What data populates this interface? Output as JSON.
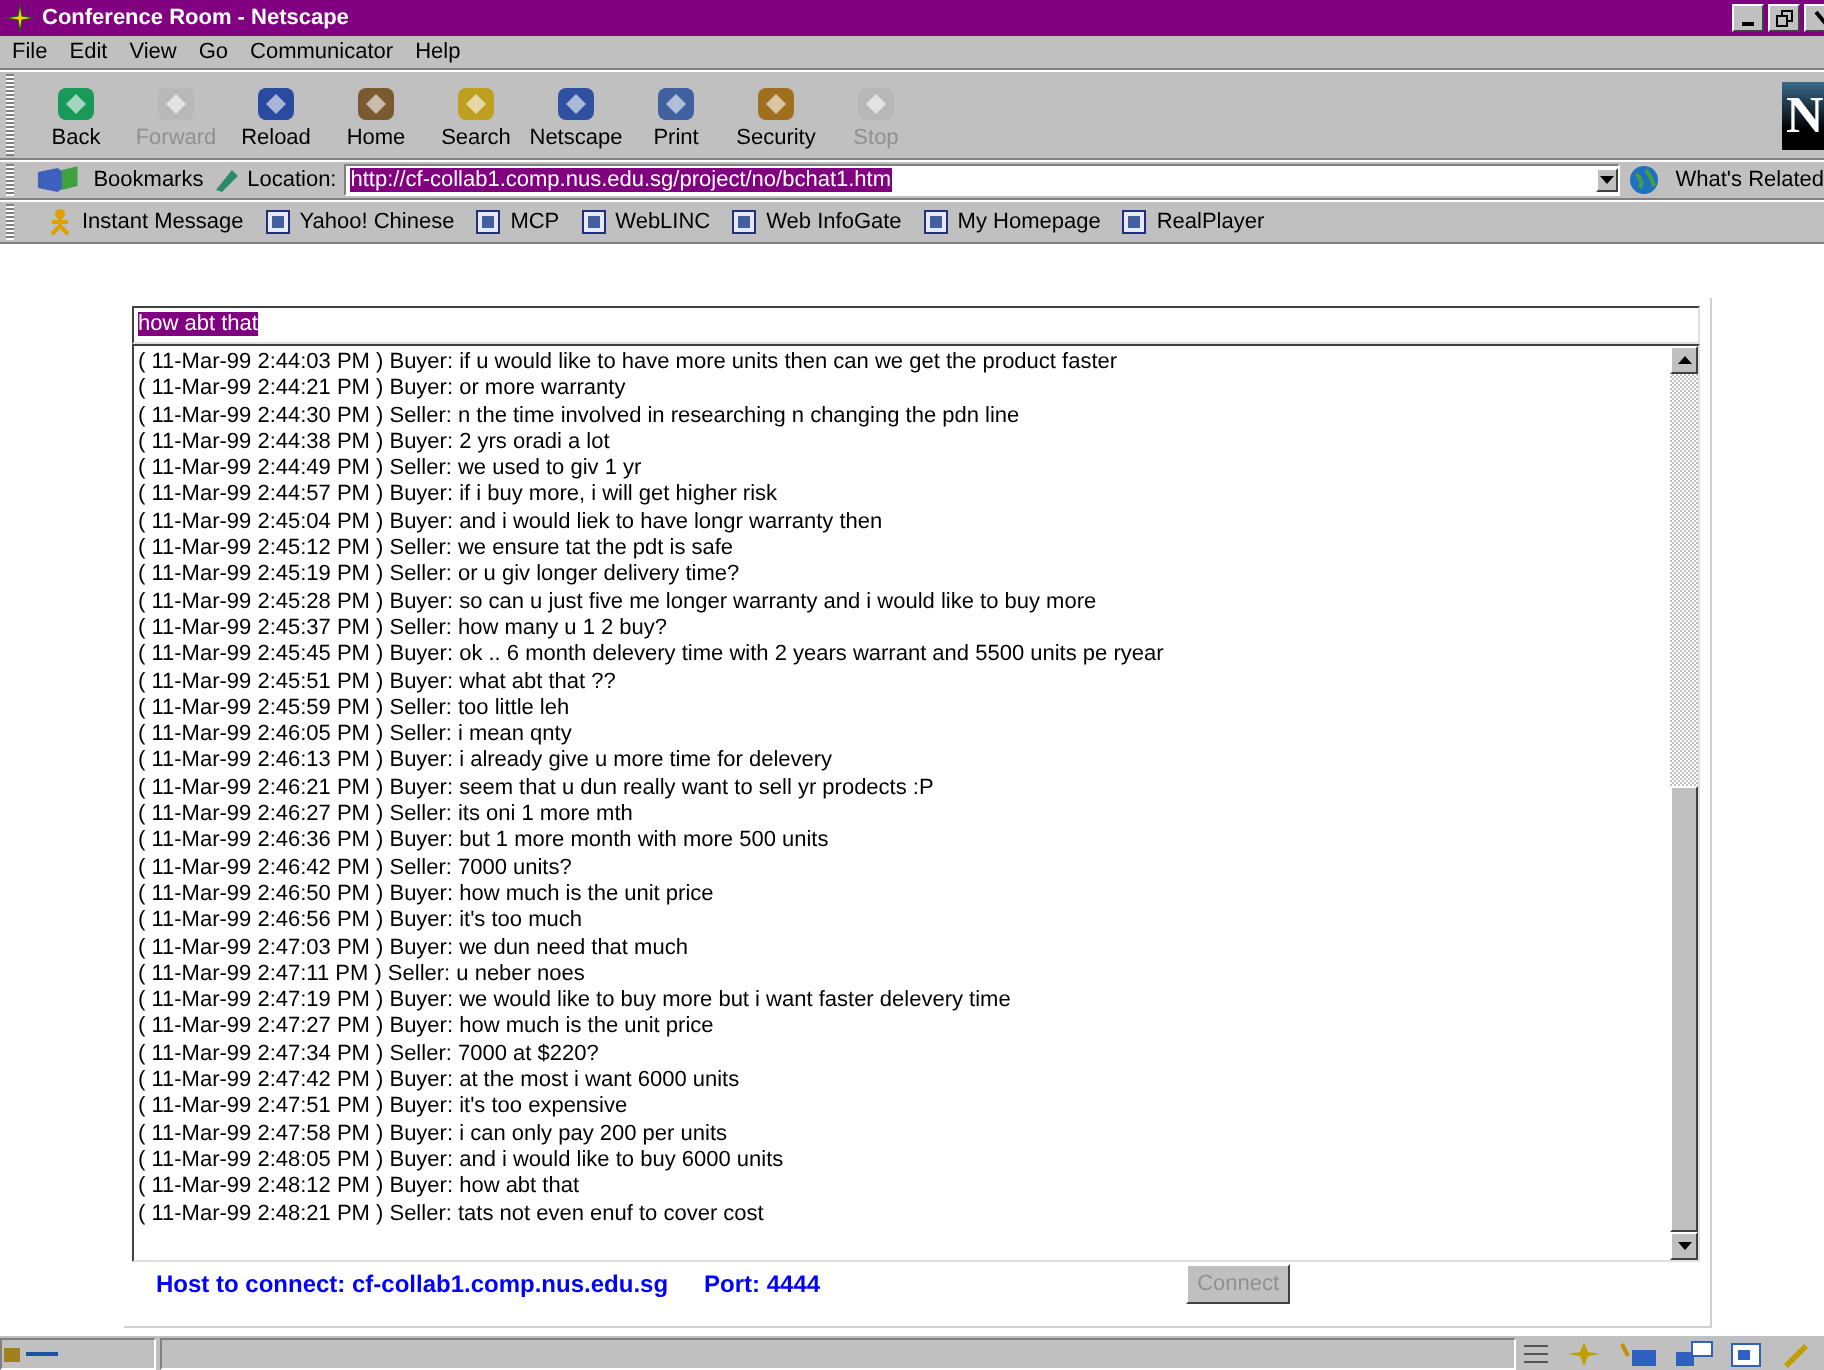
{
  "window": {
    "title": "Conference Room - Netscape"
  },
  "menu": [
    "File",
    "Edit",
    "View",
    "Go",
    "Communicator",
    "Help"
  ],
  "toolbar": [
    {
      "label": "Back",
      "disabled": false
    },
    {
      "label": "Forward",
      "disabled": true
    },
    {
      "label": "Reload",
      "disabled": false
    },
    {
      "label": "Home",
      "disabled": false
    },
    {
      "label": "Search",
      "disabled": false
    },
    {
      "label": "Netscape",
      "disabled": false
    },
    {
      "label": "Print",
      "disabled": false
    },
    {
      "label": "Security",
      "disabled": false
    },
    {
      "label": "Stop",
      "disabled": true
    }
  ],
  "logo": "N",
  "location_bar": {
    "bookmarks": "Bookmarks",
    "label": "Location:",
    "url": "http://cf-collab1.comp.nus.edu.sg/project/no/bchat1.htm",
    "url_selected": true,
    "related": "What's Related"
  },
  "personal_bar": [
    "Instant Message",
    "Yahoo! Chinese",
    "MCP",
    "WebLINC",
    "Web InfoGate",
    "My Homepage",
    "RealPlayer"
  ],
  "chat": {
    "input": "how abt that",
    "input_selected": true,
    "messages": [
      "( 11-Mar-99 2:44:03 PM ) Buyer: if u would like to have more units then can we get the product faster",
      "( 11-Mar-99 2:44:21 PM ) Buyer: or more warranty",
      "( 11-Mar-99 2:44:30 PM ) Seller: n the time involved in researching n changing the pdn line",
      "( 11-Mar-99 2:44:38 PM ) Buyer: 2 yrs oradi a lot",
      "( 11-Mar-99 2:44:49 PM ) Seller: we used to giv 1 yr",
      "( 11-Mar-99 2:44:57 PM ) Buyer: if i buy more, i will get higher risk",
      "( 11-Mar-99 2:45:04 PM ) Buyer: and i would liek to have longr warranty then",
      "( 11-Mar-99 2:45:12 PM ) Seller: we ensure tat the pdt is safe",
      "( 11-Mar-99 2:45:19 PM ) Seller: or u giv longer delivery time?",
      "( 11-Mar-99 2:45:28 PM ) Buyer: so can u just five me longer warranty and i would like to buy more",
      "( 11-Mar-99 2:45:37 PM ) Seller: how many u 1 2 buy?",
      "( 11-Mar-99 2:45:45 PM ) Buyer: ok .. 6 month delevery time with 2 years warrant and 5500 units pe ryear",
      "( 11-Mar-99 2:45:51 PM ) Buyer: what abt that ??",
      "( 11-Mar-99 2:45:59 PM ) Seller: too little leh",
      "( 11-Mar-99 2:46:05 PM ) Seller: i mean qnty",
      "( 11-Mar-99 2:46:13 PM ) Buyer: i already give u more time for delevery",
      "( 11-Mar-99 2:46:21 PM ) Buyer: seem that u dun really want to sell yr prodects :P",
      "( 11-Mar-99 2:46:27 PM ) Seller: its oni 1 more mth",
      "( 11-Mar-99 2:46:36 PM ) Buyer: but 1 more month with more 500 units",
      "( 11-Mar-99 2:46:42 PM ) Seller: 7000 units?",
      "( 11-Mar-99 2:46:50 PM ) Buyer: how much is the unit price",
      "( 11-Mar-99 2:46:56 PM ) Buyer: it's too much",
      "( 11-Mar-99 2:47:03 PM ) Buyer: we dun need that much",
      "( 11-Mar-99 2:47:11 PM ) Seller: u neber noes",
      "( 11-Mar-99 2:47:19 PM ) Buyer: we would like to buy more but i want faster delevery time",
      "( 11-Mar-99 2:47:27 PM ) Buyer: how much is the unit price",
      "( 11-Mar-99 2:47:34 PM ) Seller: 7000 at $220?",
      "( 11-Mar-99 2:47:42 PM ) Buyer: at the most i want 6000 units",
      "( 11-Mar-99 2:47:51 PM ) Buyer: it's too expensive",
      "( 11-Mar-99 2:47:58 PM ) Buyer: i can only pay 200 per units",
      "( 11-Mar-99 2:48:05 PM ) Buyer: and i would like to buy 6000 units",
      "( 11-Mar-99 2:48:12 PM ) Buyer: how abt that",
      "( 11-Mar-99 2:48:21 PM ) Seller: tats not even enuf to cover cost"
    ],
    "host": "Host to connect: cf-collab1.comp.nus.edu.sg",
    "port": "Port: 4444",
    "connect": {
      "label": "Connect",
      "disabled": true
    }
  }
}
